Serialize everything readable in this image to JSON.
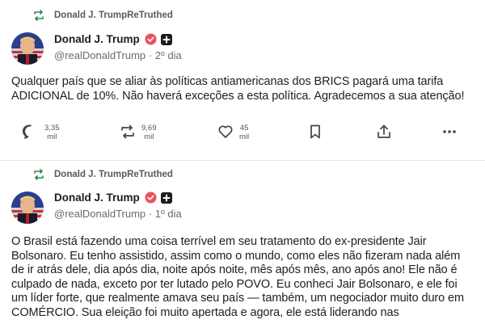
{
  "posts": [
    {
      "retruth_label": "Donald J. TrumpReTruthed",
      "display_name": "Donald J. Trump",
      "handle": "@realDonaldTrump",
      "separator": "·",
      "time": "2º dia",
      "text": "Qualquer país que se aliar às políticas antiamericanas dos BRICS pagará uma tarifa ADICIONAL de 10%. Não haverá exceções a esta política. Agradecemos a sua atenção!",
      "actions": {
        "replies": {
          "value": "3,35",
          "unit": "mil"
        },
        "retruths": {
          "value": "9,69",
          "unit": "mil"
        },
        "likes": {
          "value": "45",
          "unit": "mil"
        }
      }
    },
    {
      "retruth_label": "Donald J. TrumpReTruthed",
      "display_name": "Donald J. Trump",
      "handle": "@realDonaldTrump",
      "separator": "·",
      "time": "1º dia",
      "text": "O Brasil está fazendo uma coisa terrível em seu tratamento do ex-presidente Jair Bolsonaro. Eu tenho assistido, assim como o mundo, como eles não fizeram nada além de ir atrás dele, dia após dia, noite após noite, mês após mês, ano após ano! Ele não é culpado de nada, exceto por ter lutado pelo POVO. Eu conheci Jair Bolsonaro, e ele foi um líder forte, que realmente amava seu país — também, um negociador muito duro em COMÉRCIO. Sua eleição foi muito apertada e agora, ele está liderando nas"
    }
  ],
  "icons": {
    "retruth": "retruth-icon",
    "verified": "verified-badge-icon",
    "plus": "plus-badge-icon",
    "reply": "reply-icon",
    "repost": "retruth-action-icon",
    "like": "heart-icon",
    "bookmark": "bookmark-icon",
    "share": "share-icon",
    "more": "more-icon"
  },
  "colors": {
    "retruth_green": "#2a8a4a",
    "verified_red": "#e8545a",
    "text": "#202020",
    "muted": "#6b6b6b"
  }
}
